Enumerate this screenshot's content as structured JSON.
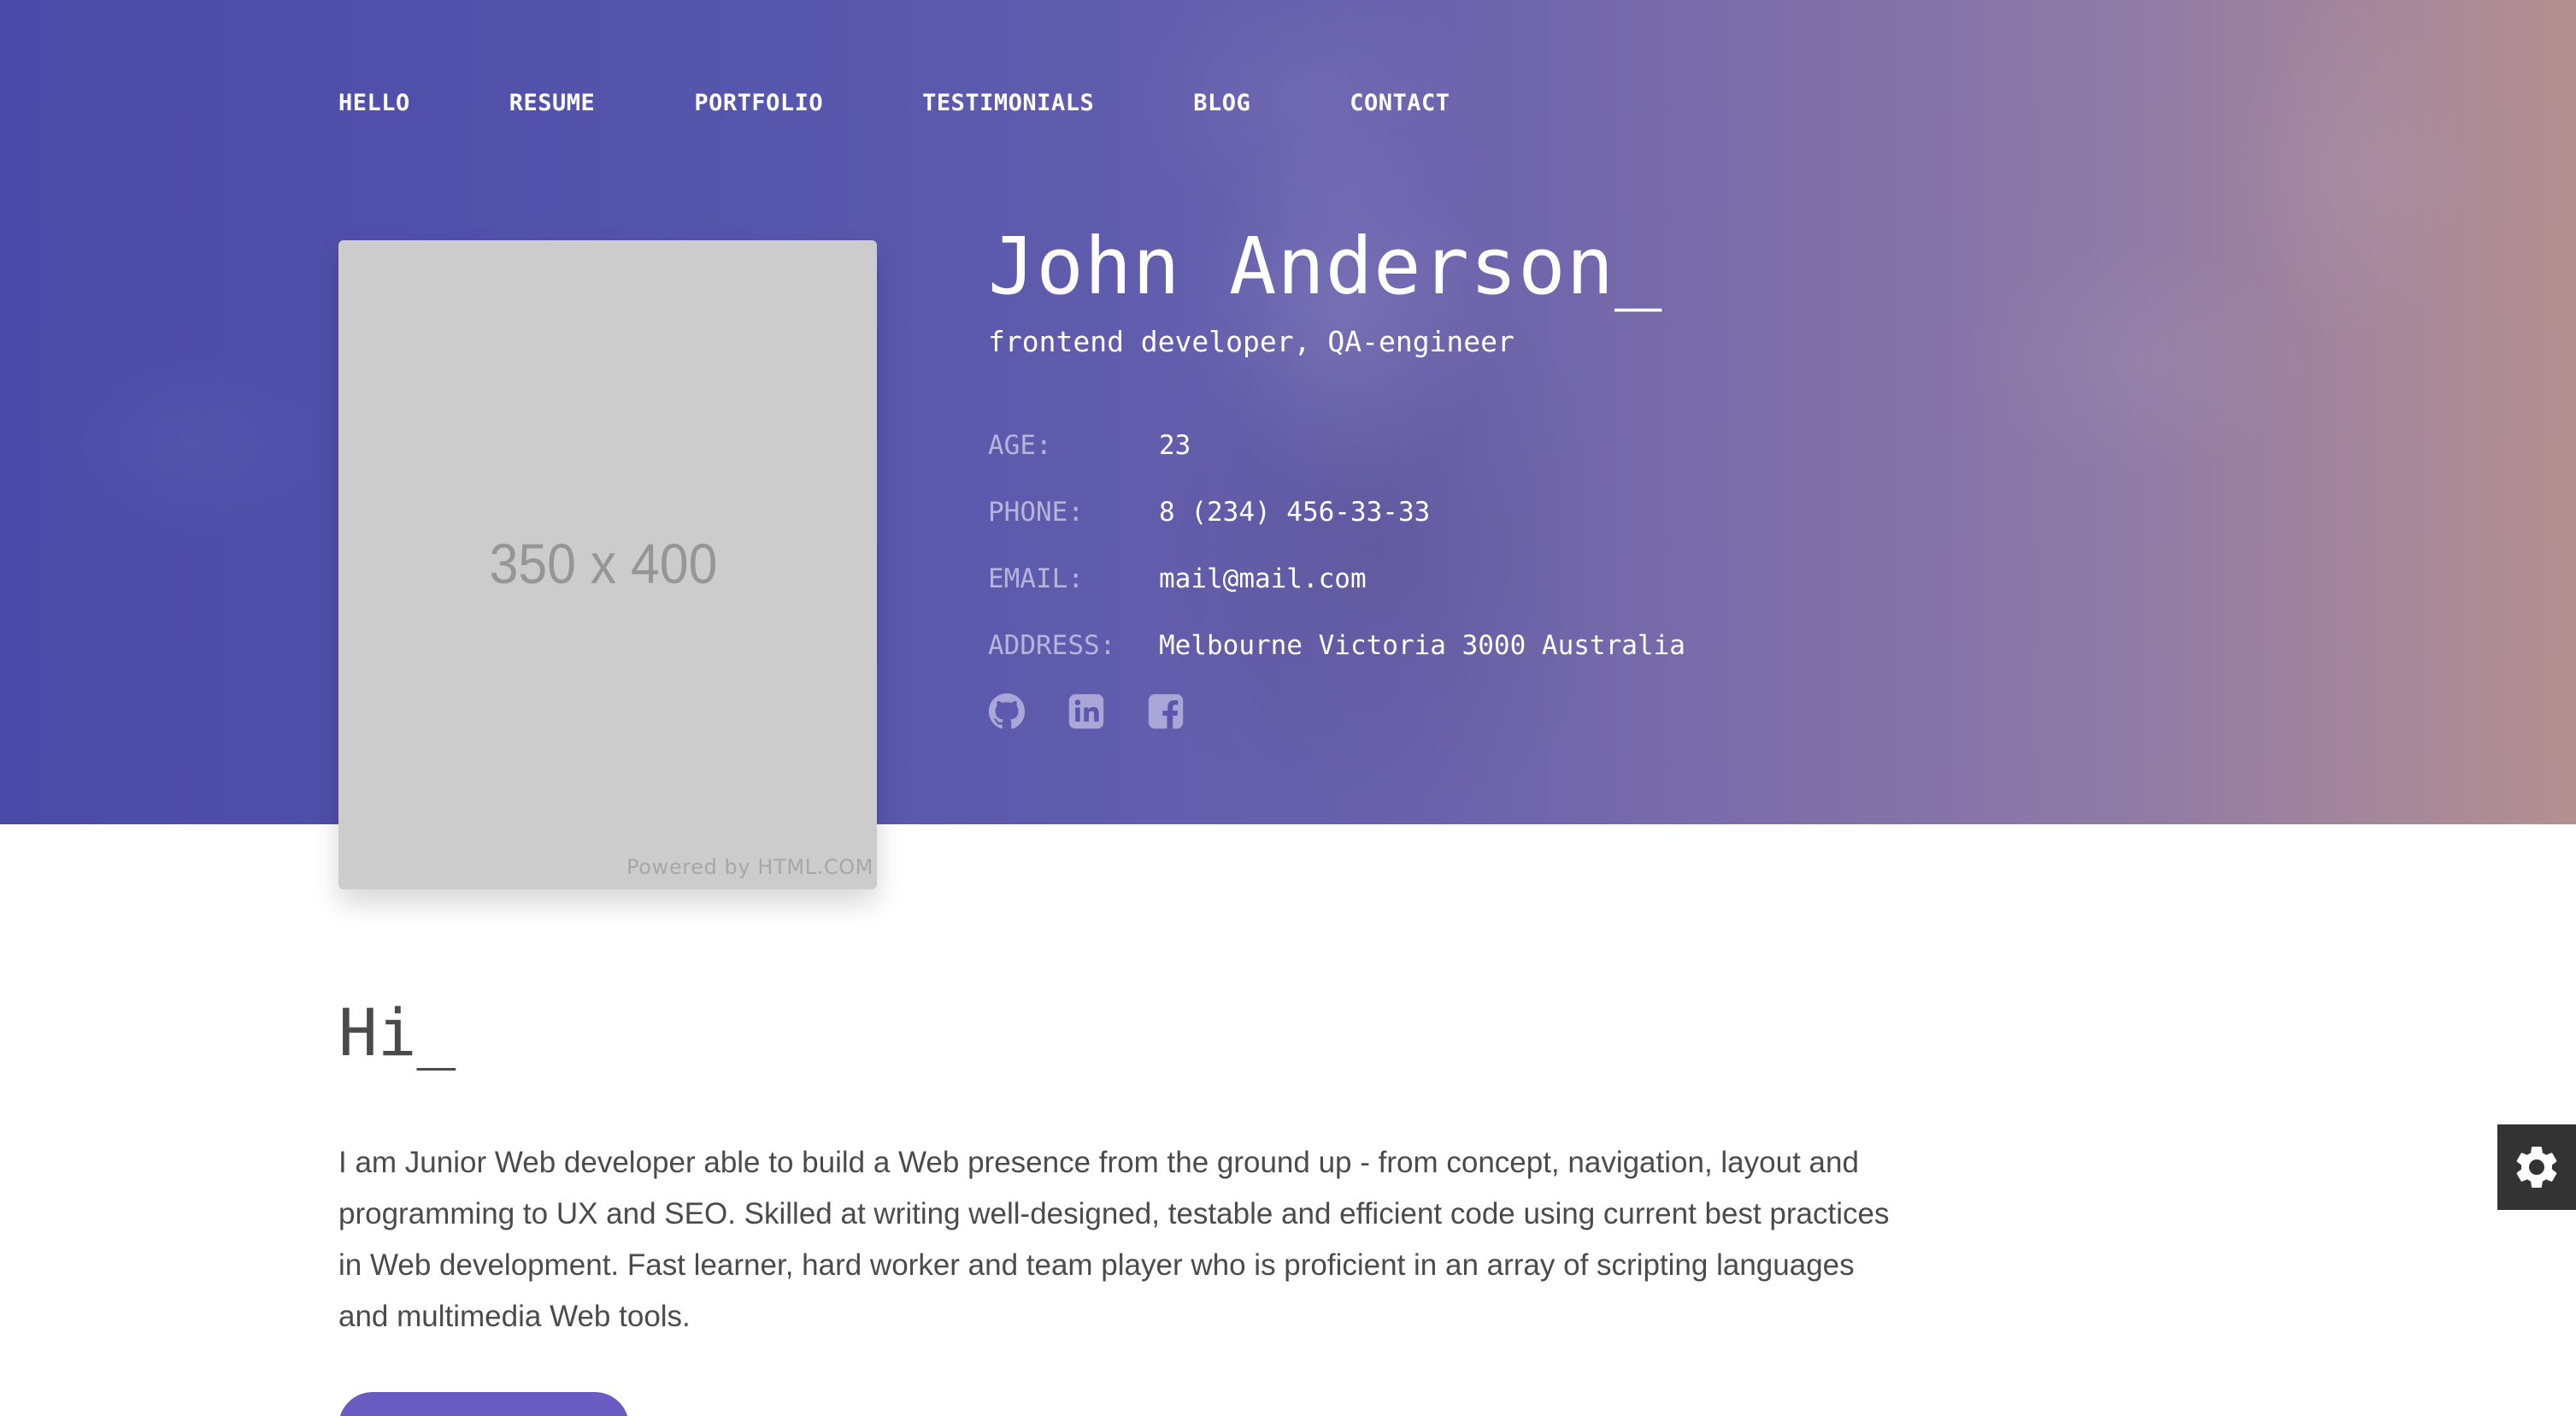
{
  "nav": {
    "items": [
      {
        "label": "HELLO"
      },
      {
        "label": "RESUME"
      },
      {
        "label": "PORTFOLIO"
      },
      {
        "label": "TESTIMONIALS"
      },
      {
        "label": "BLOG"
      },
      {
        "label": "CONTACT"
      }
    ]
  },
  "photo": {
    "placeholder_text": "350 x 400",
    "credit": "Powered by HTML.COM"
  },
  "profile": {
    "name": "John Anderson_",
    "role": "frontend developer, QA-engineer",
    "info": [
      {
        "label": "AGE:",
        "value": "23"
      },
      {
        "label": "PHONE:",
        "value": "8 (234) 456-33-33"
      },
      {
        "label": "EMAIL:",
        "value": "mail@mail.com"
      },
      {
        "label": "ADDRESS:",
        "value": "Melbourne Victoria 3000 Australia"
      }
    ],
    "socials": [
      {
        "icon": "github-icon"
      },
      {
        "icon": "linkedin-icon"
      },
      {
        "icon": "facebook-icon"
      }
    ]
  },
  "about": {
    "title": "Hi_",
    "text": "I am Junior Web developer able to build a Web presence from the ground up - from concept, navigation, layout and programming to UX and SEO. Skilled at writing well-designed, testable and efficient code using current best practices in Web development. Fast learner, hard worker and team player who is proficient in an array of scripting languages and multimedia Web tools."
  },
  "settings": {
    "icon": "gear-icon"
  },
  "colors": {
    "hero_start": "#4a4aa8",
    "hero_end": "#b59091",
    "accent": "#6a5bc2",
    "settings_bg": "#333333"
  }
}
